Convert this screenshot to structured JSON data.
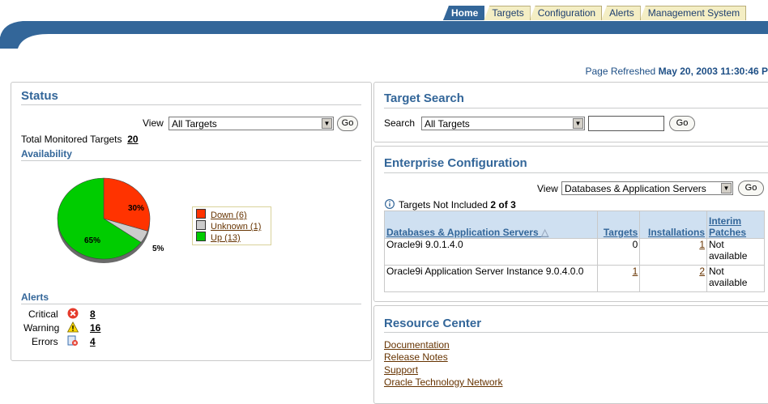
{
  "tabs": [
    {
      "label": "Home",
      "active": true
    },
    {
      "label": "Targets",
      "active": false
    },
    {
      "label": "Configuration",
      "active": false
    },
    {
      "label": "Alerts",
      "active": false
    },
    {
      "label": "Management System",
      "active": false
    }
  ],
  "refresh": {
    "prefix": "Page Refreshed",
    "timestamp": "May 20, 2003 11:30:46 P"
  },
  "status": {
    "title": "Status",
    "view_label": "View",
    "view_value": "All Targets",
    "go_label": "Go",
    "total_label": "Total Monitored Targets",
    "total_value": "20",
    "availability_title": "Availability",
    "pie": {
      "slices": [
        {
          "name": "Down",
          "percent": 30,
          "label": "30%",
          "color": "#ff3300"
        },
        {
          "name": "Unknown",
          "percent": 5,
          "label": "5%",
          "color": "#cccccc"
        },
        {
          "name": "Up",
          "percent": 65,
          "label": "65%",
          "color": "#00cc00"
        }
      ]
    },
    "legend": [
      "Down (6)",
      "Unknown (1)",
      "Up (13)"
    ],
    "alerts_title": "Alerts",
    "alerts": [
      {
        "label": "Critical",
        "value": "8",
        "icon": "critical-icon"
      },
      {
        "label": "Warning",
        "value": "16",
        "icon": "warning-icon"
      },
      {
        "label": "Errors",
        "value": "4",
        "icon": "error-icon"
      }
    ]
  },
  "search": {
    "title": "Target Search",
    "search_label": "Search",
    "search_value": "All Targets",
    "text_value": "",
    "go_label": "Go"
  },
  "enterprise": {
    "title": "Enterprise Configuration",
    "view_label": "View",
    "view_value": "Databases & Application Servers",
    "go_label": "Go",
    "not_included_label": "Targets Not Included",
    "not_included_value": "2 of 3",
    "headers": [
      "Databases & Application Servers",
      "Targets",
      "Installations",
      "Interim Patches"
    ],
    "rows": [
      {
        "name": "Oracle9i 9.0.1.4.0",
        "targets": "0",
        "installations": "1",
        "patches": "Not available"
      },
      {
        "name": "Oracle9i Application Server Instance 9.0.4.0.0",
        "targets": "1",
        "installations": "2",
        "patches": "Not available"
      }
    ]
  },
  "resource": {
    "title": "Resource Center",
    "links": [
      "Documentation",
      "Release Notes",
      "Support",
      "Oracle Technology Network"
    ]
  }
}
